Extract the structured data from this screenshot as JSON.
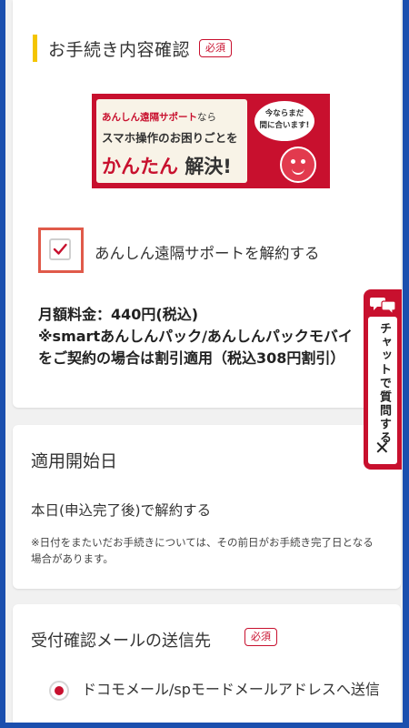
{
  "section1": {
    "title": "お手続き内容確認",
    "required_badge": "必須",
    "banner": {
      "line1_red": "あんしん遠隔サポート",
      "line1_tail": "なら",
      "line2": "スマホ操作のお困りごとを",
      "line3_red": "かんたん",
      "line3_dark": "解決!",
      "bubble_line1": "今ならまだ",
      "bubble_line2": "間に合います!"
    },
    "checkbox_label": "あんしん遠隔サポートを解約する",
    "checkbox_checked": true,
    "fee_lines": [
      "月額料金：440円(税込)",
      "※smartあんしんパック/あんしんパックモバイ",
      "をご契約の場合は割引適用（税込308円割引）"
    ]
  },
  "section2": {
    "title": "適用開始日",
    "value": "本日(申込完了後)で解約する",
    "note": "※日付をまたいだお手続きについては、その前日がお手続き完了日となる場合があります。"
  },
  "section3": {
    "title": "受付確認メールの送信先",
    "required_badge": "必須",
    "radio_label": "ドコモメール/spモードメールアドレスへ送信",
    "radio_selected": true
  },
  "chat_tab": {
    "label": "チャットで質問する",
    "close": "✕"
  },
  "colors": {
    "brand_red": "#c8102e",
    "accent_yellow": "#f4c500",
    "frame_blue": "#1b4fae",
    "highlight_border": "#e05a4a"
  }
}
